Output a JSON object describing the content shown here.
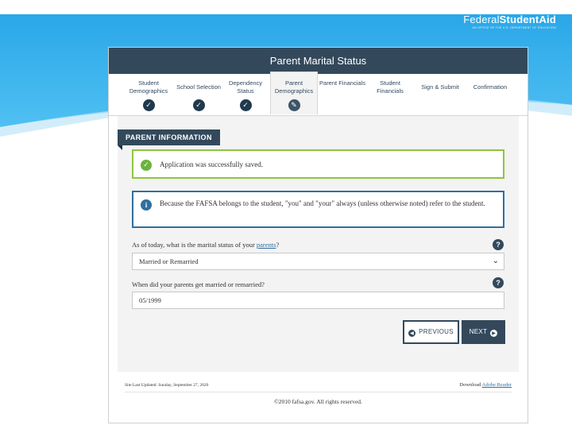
{
  "brand": {
    "name_bold_part1": "Federal",
    "name_bold_part2": "StudentAid",
    "subtitle": "AN OFFICE OF THE U.S. DEPARTMENT OF EDUCATION"
  },
  "panel": {
    "title": "Parent Marital Status"
  },
  "steps": [
    {
      "label": "Student Demographics",
      "status": "complete",
      "icon": "check-icon"
    },
    {
      "label": "School Selection",
      "status": "complete",
      "icon": "check-icon"
    },
    {
      "label": "Dependency Status",
      "status": "complete",
      "icon": "check-icon"
    },
    {
      "label": "Parent Demographics",
      "status": "active",
      "icon": "pencil-icon"
    },
    {
      "label": "Parent Financials",
      "status": "pending"
    },
    {
      "label": "Student Financials",
      "status": "pending"
    },
    {
      "label": "Sign & Submit",
      "status": "pending"
    },
    {
      "label": "Confirmation",
      "status": "pending"
    }
  ],
  "section": {
    "tag": "PARENT INFORMATION"
  },
  "alerts": {
    "success": "Application was successfully saved.",
    "info": "Because the FAFSA belongs to the student, \"you\" and \"your\" always (unless otherwise noted) refer to the student."
  },
  "questions": {
    "marital_prefix": "As of today, what is the marital status of your",
    "marital_link": "parents",
    "marital_suffix": "?",
    "marital_value": "Married or Remarried",
    "date_label": "When did your parents get married or remarried?",
    "date_value": "05/1999",
    "help_glyph": "?"
  },
  "buttons": {
    "previous": "PREVIOUS",
    "next": "NEXT"
  },
  "footer": {
    "last_updated": "Site Last Updated: Sunday, September 27, 2020",
    "download_prefix": "Download",
    "download_link": "Adobe Reader",
    "copyright": "©2010 fafsa.gov. All rights reserved."
  },
  "colors": {
    "header": "#33495b",
    "success_border": "#8dc63f",
    "info_border": "#2f6f9e",
    "slide_blue": "#1e9be0"
  }
}
